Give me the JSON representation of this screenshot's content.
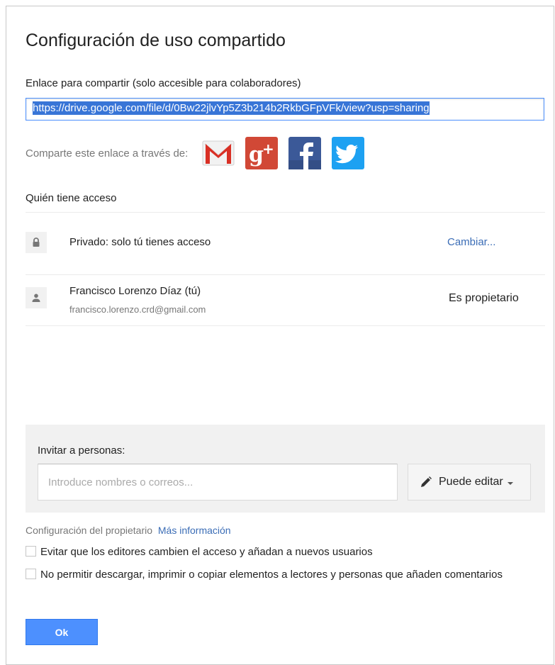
{
  "dialog": {
    "title": "Configuración de uso compartido",
    "link_label": "Enlace para compartir (solo accesible para colaboradores)",
    "link_url": "https://drive.google.com/file/d/0Bw22jlvYp5Z3b214b2RkbGFpVFk/view?usp=sharing",
    "share_via_label": "Comparte este enlace a través de:",
    "share_icons": [
      "gmail-icon",
      "google-plus-icon",
      "facebook-icon",
      "twitter-icon"
    ]
  },
  "access": {
    "title": "Quién tiene acceso",
    "private_text": "Privado: solo tú tienes acceso",
    "change_link": "Cambiar...",
    "owner_name": "Francisco Lorenzo Díaz (tú)",
    "owner_email": "francisco.lorenzo.crd@gmail.com",
    "owner_role": "Es propietario"
  },
  "invite": {
    "label": "Invitar a personas:",
    "placeholder": "Introduce nombres o correos...",
    "permission": "Puede editar"
  },
  "owner_settings": {
    "label": "Configuración del propietario",
    "more_info": "Más información",
    "option_1": "Evitar que los editores cambien el acceso y añadan a nuevos usuarios",
    "option_2": "No permitir descargar, imprimir o copiar elementos a lectores y personas que añaden comentarios"
  },
  "ok_button": "Ok",
  "colors": {
    "accent": "#4d90fe",
    "link": "#3b6db6",
    "gmail_red": "#d93025",
    "google_plus": "#d14836",
    "facebook": "#3b5998",
    "twitter": "#1da1f2"
  }
}
